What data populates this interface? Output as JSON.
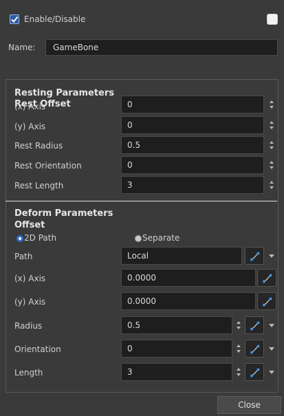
{
  "enable": {
    "label": "Enable/Disable",
    "checked": true
  },
  "name": {
    "label": "Name:",
    "value": "GameBone"
  },
  "resting": {
    "title": "Resting Parameters",
    "subtitle": "Rest Offset",
    "rows": [
      {
        "label": "(x) Axis",
        "value": "0"
      },
      {
        "label": "(y) Axis",
        "value": "0"
      },
      {
        "label": "Rest Radius",
        "value": "0.5"
      },
      {
        "label": "Rest Orientation",
        "value": "0"
      },
      {
        "label": "Rest Length",
        "value": "3"
      }
    ]
  },
  "deform": {
    "title": "Deform Parameters",
    "subtitle": "Offset",
    "mode_2d": "2D Path",
    "mode_separate": "Separate",
    "path": {
      "label": "Path",
      "value": "Local"
    },
    "x_axis": {
      "label": "(x) Axis",
      "value": "0.0000"
    },
    "y_axis": {
      "label": "(y) Axis",
      "value": "0.0000"
    },
    "radius": {
      "label": "Radius",
      "value": "0.5"
    },
    "orientation": {
      "label": "Orientation",
      "value": "0"
    },
    "length": {
      "label": "Length",
      "value": "3"
    }
  },
  "close_label": "Close",
  "colors": {
    "checkbox": "#2c5aa6",
    "function_icon": "#3a8fe0",
    "separator": "#e4e4e4"
  }
}
